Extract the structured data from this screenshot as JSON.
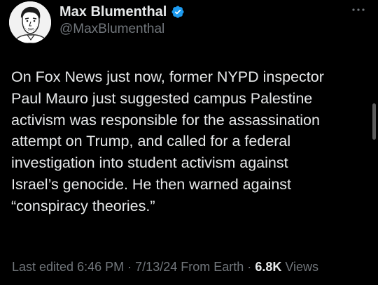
{
  "author": {
    "display_name": "Max Blumenthal",
    "handle": "@MaxBlumenthal",
    "verified": true,
    "verified_color": "#1d9bf0",
    "avatar": "cartoon-portrait-avatar"
  },
  "more_icon": "more-dots-icon",
  "post": {
    "text": "On Fox News just now, former NYPD inspector\nPaul Mauro just suggested campus Palestine\nactivism was responsible for the assassination\nattempt on Trump, and called for a federal\ninvestigation into student activism against\nIsrael’s genocide. He then warned against\n“conspiracy theories.”"
  },
  "meta": {
    "edited_label": "Last edited",
    "time": "6:46 PM",
    "separator": "·",
    "date": "7/13/24",
    "source": "From Earth",
    "views_count": "6.8K",
    "views_label": "Views"
  },
  "colors": {
    "background": "#000000",
    "primary_text": "#e7e9ea",
    "secondary_text": "#71767b"
  }
}
